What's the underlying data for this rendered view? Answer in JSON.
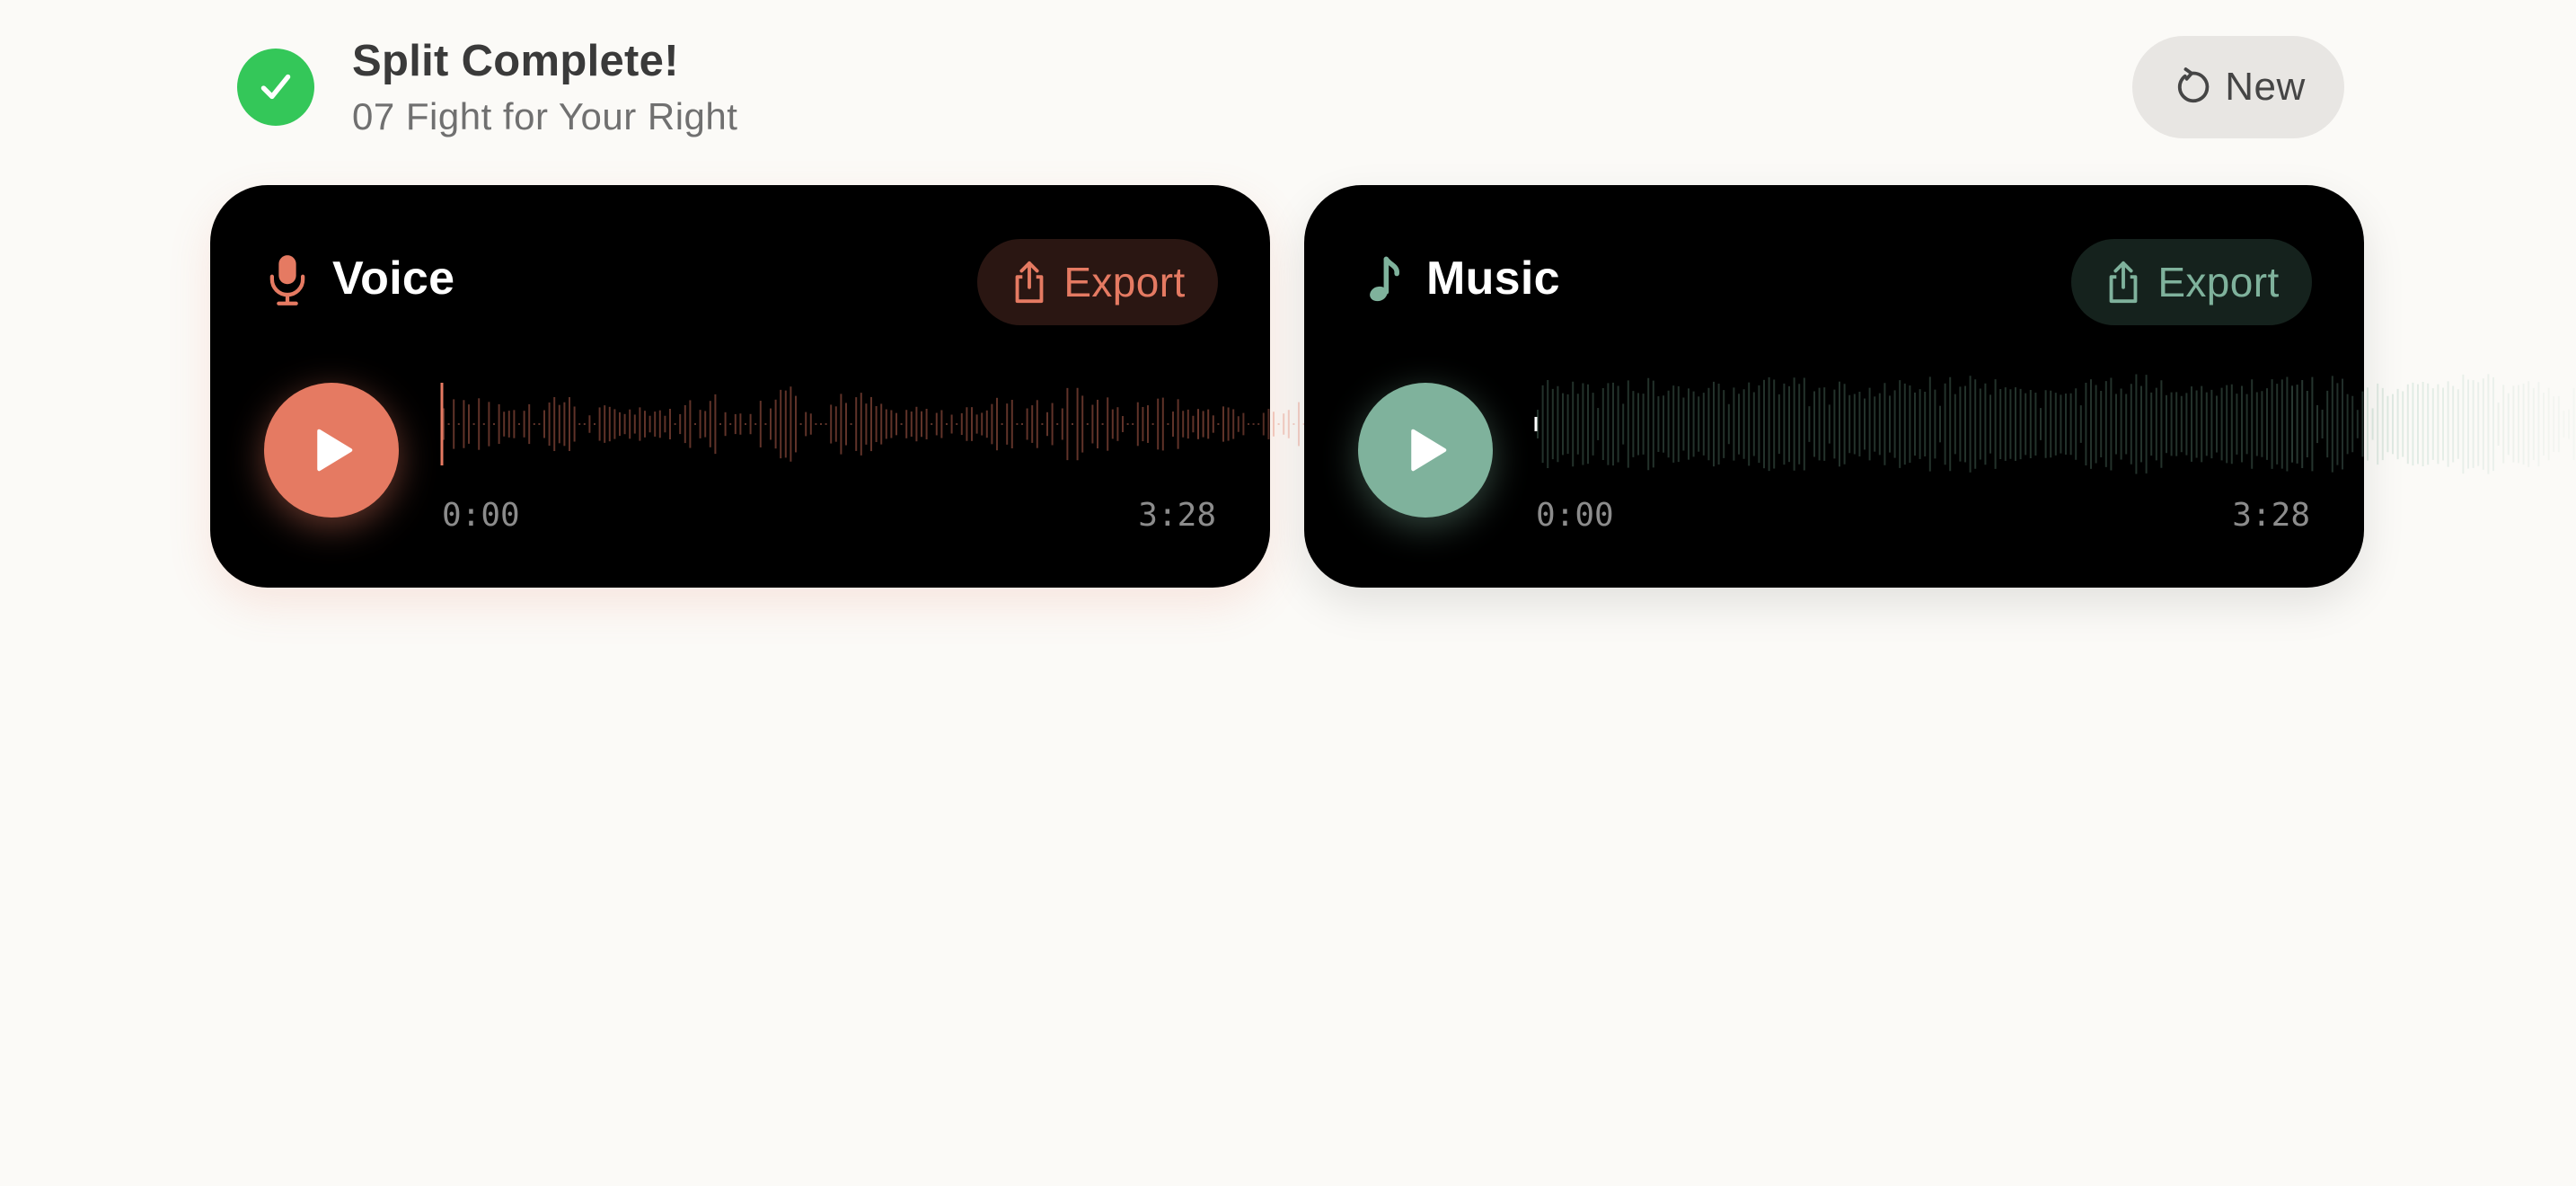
{
  "header": {
    "title": "Split Complete!",
    "subtitle": "07 Fight for Your Right",
    "new_label": "New"
  },
  "tracks": [
    {
      "id": "voice",
      "label": "Voice",
      "icon": "microphone-icon",
      "export_label": "Export",
      "current_time": "0:00",
      "total_time": "3:28",
      "accent": "#e57a62",
      "progress": 0
    },
    {
      "id": "music",
      "label": "Music",
      "icon": "music-note-icon",
      "export_label": "Export",
      "current_time": "0:00",
      "total_time": "3:28",
      "accent": "#7fb29c",
      "progress": 0
    }
  ],
  "colors": {
    "background": "#fbfaf7",
    "card": "#000000",
    "success": "#34c759",
    "voice_accent": "#e57a62",
    "music_accent": "#7fb29c"
  }
}
